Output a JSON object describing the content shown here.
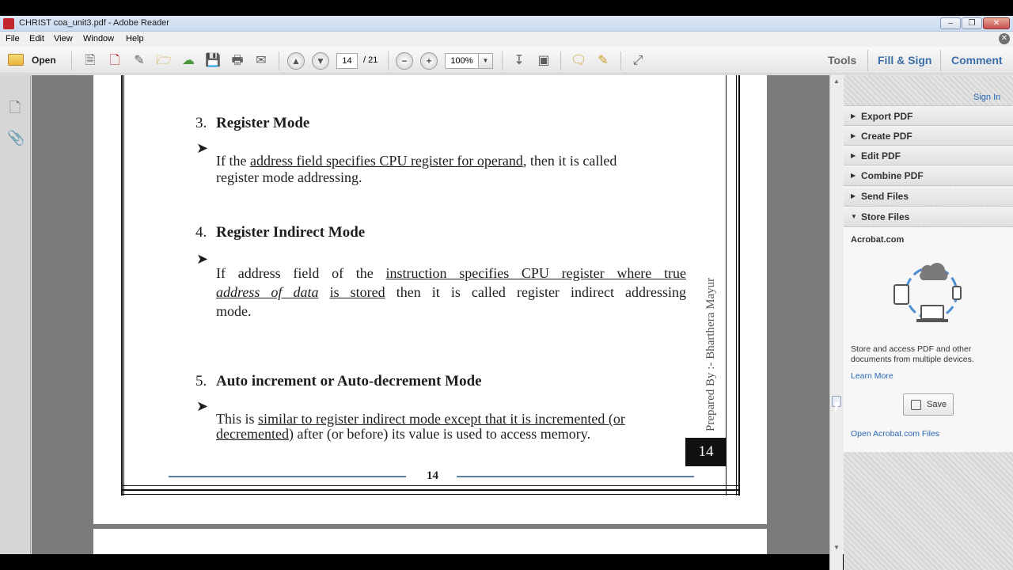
{
  "window": {
    "title": "CHRIST coa_unit3.pdf - Adobe Reader"
  },
  "menu": [
    "File",
    "Edit",
    "View",
    "Window",
    "Help"
  ],
  "toolbar": {
    "open_label": "Open",
    "page_current": "14",
    "page_total": "/ 21",
    "zoom": "100%",
    "tabs": {
      "tools": "Tools",
      "fill_sign": "Fill & Sign",
      "comment": "Comment"
    }
  },
  "document": {
    "sections": [
      {
        "num": "3.",
        "title": "Register Mode"
      },
      {
        "num": "4.",
        "title": "Register Indirect Mode"
      },
      {
        "num": "5.",
        "title": "Auto increment or Auto-decrement Mode"
      }
    ],
    "p3": {
      "a": "If the ",
      "b": "address field specifies CPU register for operand",
      "c": ", then it is called",
      "d": "register mode addressing."
    },
    "p4": {
      "a": "If address field of the ",
      "b": "instruction specifies CPU register where true",
      "c": "address of data",
      "d": "is stored",
      "e": " then it is called register indirect addressing",
      "f": "mode."
    },
    "p5": {
      "a": "This is ",
      "b": "similar to register indirect mode except that it is incremented (or",
      "c": "decremented)",
      "d": " after (or before) its value is used to access memory."
    },
    "side_text": "Prepared By :- Bharthera Mayur",
    "page_box": "14",
    "footer_num": "14"
  },
  "right_panel": {
    "sign_in": "Sign In",
    "sections": [
      "Export PDF",
      "Create PDF",
      "Edit PDF",
      "Combine PDF",
      "Send Files",
      "Store Files"
    ],
    "store": {
      "brand": "Acrobat.com",
      "description": "Store and access PDF and other documents from multiple devices.",
      "learn_more": "Learn More",
      "save": "Save",
      "open_files": "Open Acrobat.com Files"
    }
  },
  "colors": {
    "accent_blue": "#2a68b5",
    "footer_rule": "#5b7fa6",
    "doc_bg": "#7b7b7b"
  }
}
